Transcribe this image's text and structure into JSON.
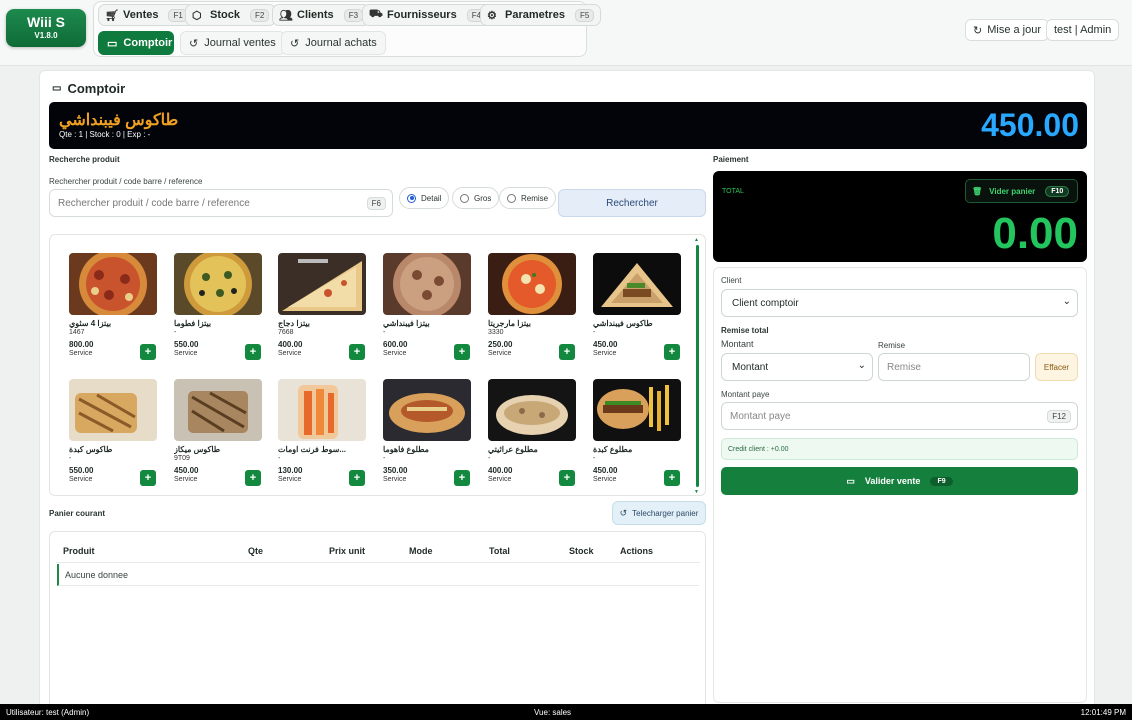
{
  "app": {
    "logo_name": "Wiii S",
    "logo_version": "V1.8.0"
  },
  "nav": {
    "tabs": [
      {
        "label": "Ventes",
        "key": "F1"
      },
      {
        "label": "Stock",
        "key": "F2"
      },
      {
        "label": "Clients",
        "key": "F3"
      },
      {
        "label": "Fournisseurs",
        "key": "F4"
      },
      {
        "label": "Parametres",
        "key": "F5"
      }
    ],
    "subtabs": [
      "Comptoir",
      "Journal ventes",
      "Journal achats"
    ]
  },
  "header": {
    "update_label": "Mise a jour",
    "user_label": "test | Admin"
  },
  "page": {
    "title": "Comptoir"
  },
  "banner": {
    "product_name": "طاكوس فيبنداشي",
    "meta": "Qte : 1 | Stock : 0 | Exp : -",
    "price": "450.00"
  },
  "search": {
    "section_label": "Recherche produit",
    "field_label": "Rechercher produit / code barre / reference",
    "placeholder": "Rechercher produit / code barre / reference",
    "key": "F6",
    "modes": [
      "Detail",
      "Gros",
      "Remise"
    ],
    "selected_mode": "Detail",
    "button_label": "Rechercher"
  },
  "products": [
    {
      "name": "بيتزا 4 سثوي",
      "ref": "1467",
      "price": "800.00",
      "mode": "Service"
    },
    {
      "name": "بيتزا فطوما",
      "ref": "-",
      "price": "550.00",
      "mode": "Service"
    },
    {
      "name": "بيتزا دجاج",
      "ref": "7668",
      "price": "400.00",
      "mode": "Service"
    },
    {
      "name": "بيتزا فيبنداشي",
      "ref": "-",
      "price": "600.00",
      "mode": "Service"
    },
    {
      "name": "بيتزا مارجريتا",
      "ref": "3330",
      "price": "250.00",
      "mode": "Service"
    },
    {
      "name": "طاكوس فيبنداشي",
      "ref": "-",
      "price": "450.00",
      "mode": "Service"
    },
    {
      "name": "طاكوس كبدة",
      "ref": "-",
      "price": "550.00",
      "mode": "Service"
    },
    {
      "name": "طاكوس ميكاز",
      "ref": "9T09",
      "price": "450.00",
      "mode": "Service"
    },
    {
      "name": "...سوط فرنت اومات",
      "ref": "-",
      "price": "130.00",
      "mode": "Service"
    },
    {
      "name": "مطلوع فاهوما",
      "ref": "-",
      "price": "350.00",
      "mode": "Service"
    },
    {
      "name": "مطلوع عراثيتي",
      "ref": "-",
      "price": "400.00",
      "mode": "Service"
    },
    {
      "name": "مطلوع كبدة",
      "ref": "-",
      "price": "450.00",
      "mode": "Service"
    }
  ],
  "cart": {
    "section_label": "Panier courant",
    "download_label": "Telecharger panier",
    "columns": [
      "Produit",
      "Qte",
      "Prix unit",
      "Mode",
      "Total",
      "Stock",
      "Actions"
    ],
    "empty_text": "Aucune donnee"
  },
  "payment": {
    "section_label": "Paiement",
    "total_label": "TOTAL",
    "clear_label": "Vider panier",
    "clear_key": "F10",
    "total_value": "0.00",
    "client_label": "Client",
    "client_value": "Client comptoir",
    "remise_total_label": "Remise total",
    "montant_label": "Montant",
    "montant_value": "Montant",
    "remise_label": "Remise",
    "remise_placeholder": "Remise",
    "effacer_label": "Effacer",
    "montant_paye_label": "Montant paye",
    "montant_paye_placeholder": "Montant paye",
    "montant_paye_key": "F12",
    "credit_text": "Credit client : +0.00",
    "validate_label": "Valider vente",
    "validate_key": "F9"
  },
  "status": {
    "user": "Utilisateur: test (Admin)",
    "view": "Vue: sales",
    "time": "12:01:49 PM"
  }
}
